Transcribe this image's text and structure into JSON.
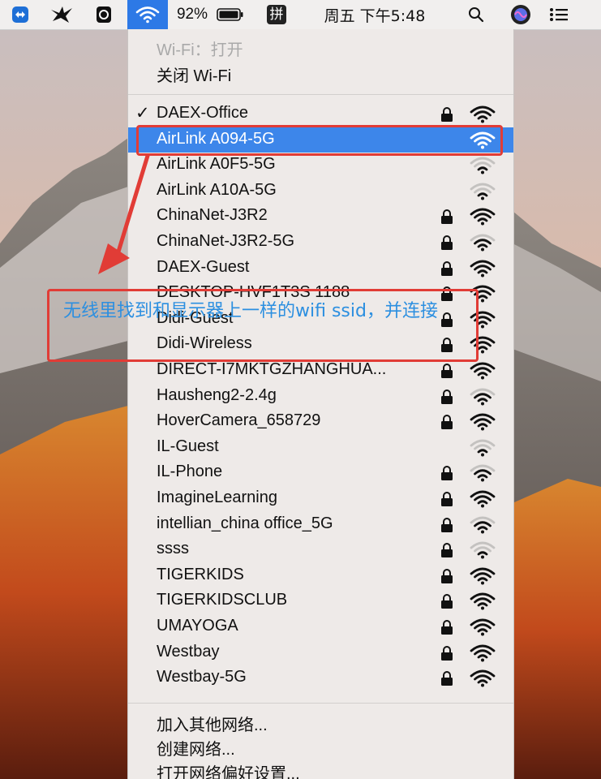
{
  "menubar": {
    "battery": "92%",
    "ime": "拼",
    "clock": "周五 下午5:48"
  },
  "wifi_menu": {
    "status": "Wi-Fi：打开",
    "toggle": "关闭 Wi-Fi",
    "networks": [
      {
        "name": "DAEX-Office",
        "lock": true,
        "signal": 4,
        "connected": true,
        "selected": false
      },
      {
        "name": "AirLink A094-5G",
        "lock": false,
        "signal": 4,
        "connected": false,
        "selected": true
      },
      {
        "name": "AirLink A0F5-5G",
        "lock": false,
        "signal": 2,
        "connected": false,
        "selected": false
      },
      {
        "name": "AirLink A10A-5G",
        "lock": false,
        "signal": 2,
        "connected": false,
        "selected": false
      },
      {
        "name": "ChinaNet-J3R2",
        "lock": true,
        "signal": 4,
        "connected": false,
        "selected": false
      },
      {
        "name": "ChinaNet-J3R2-5G",
        "lock": true,
        "signal": 3,
        "connected": false,
        "selected": false
      },
      {
        "name": "DAEX-Guest",
        "lock": true,
        "signal": 4,
        "connected": false,
        "selected": false
      },
      {
        "name": "DESKTOP-HVF1T3S 1188",
        "lock": true,
        "signal": 4,
        "connected": false,
        "selected": false
      },
      {
        "name": "Didi-Guest",
        "lock": true,
        "signal": 4,
        "connected": false,
        "selected": false
      },
      {
        "name": "Didi-Wireless",
        "lock": true,
        "signal": 4,
        "connected": false,
        "selected": false
      },
      {
        "name": "DIRECT-I7MKTGZHANGHUA...",
        "lock": true,
        "signal": 4,
        "connected": false,
        "selected": false
      },
      {
        "name": "Hausheng2-2.4g",
        "lock": true,
        "signal": 3,
        "connected": false,
        "selected": false
      },
      {
        "name": "HoverCamera_658729",
        "lock": true,
        "signal": 4,
        "connected": false,
        "selected": false
      },
      {
        "name": "IL-Guest",
        "lock": false,
        "signal": 2,
        "connected": false,
        "selected": false
      },
      {
        "name": "IL-Phone",
        "lock": true,
        "signal": 3,
        "connected": false,
        "selected": false
      },
      {
        "name": "ImagineLearning",
        "lock": true,
        "signal": 4,
        "connected": false,
        "selected": false
      },
      {
        "name": "intellian_china office_5G",
        "lock": true,
        "signal": 3,
        "connected": false,
        "selected": false
      },
      {
        "name": "ssss",
        "lock": true,
        "signal": 2,
        "connected": false,
        "selected": false
      },
      {
        "name": "TIGERKIDS",
        "lock": true,
        "signal": 4,
        "connected": false,
        "selected": false
      },
      {
        "name": "TIGERKIDSCLUB",
        "lock": true,
        "signal": 4,
        "connected": false,
        "selected": false
      },
      {
        "name": "UMAYOGA",
        "lock": true,
        "signal": 4,
        "connected": false,
        "selected": false
      },
      {
        "name": "Westbay",
        "lock": true,
        "signal": 4,
        "connected": false,
        "selected": false
      },
      {
        "name": "Westbay-5G",
        "lock": true,
        "signal": 4,
        "connected": false,
        "selected": false
      }
    ],
    "footer": {
      "join_other": "加入其他网络...",
      "create": "创建网络...",
      "prefs": "打开网络偏好设置..."
    }
  },
  "annotation": {
    "text": "无线里找到和显示器上一样的wifi ssid，并连接",
    "color": "#2c8fe0",
    "box_color": "#e13c36"
  },
  "colors": {
    "selection": "#3d86ea",
    "menu_bg": "#eeeae8"
  }
}
